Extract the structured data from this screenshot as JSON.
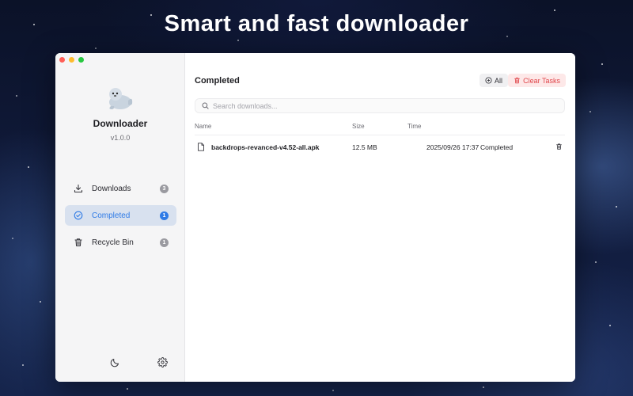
{
  "hero": {
    "title": "Smart and fast downloader"
  },
  "app": {
    "name": "Downloader",
    "version": "v1.0.0"
  },
  "sidebar": {
    "items": [
      {
        "label": "Downloads",
        "count": "3",
        "icon": "download-icon"
      },
      {
        "label": "Completed",
        "count": "1",
        "icon": "check-circle-icon",
        "active": true
      },
      {
        "label": "Recycle Bin",
        "count": "1",
        "icon": "trash-icon"
      }
    ],
    "footer": {
      "theme_icon": "moon-icon",
      "settings_icon": "gear-icon"
    }
  },
  "main": {
    "title": "Completed",
    "filter_button": "All",
    "clear_button": "Clear Tasks",
    "search": {
      "placeholder": "Search downloads...",
      "value": ""
    },
    "columns": {
      "name": "Name",
      "size": "Size",
      "time": "Time"
    },
    "rows": [
      {
        "name": "backdrops-revanced-v4.52-all.apk",
        "size": "12.5 MB",
        "time": "2025/09/26 17:37",
        "status": "Completed"
      }
    ]
  },
  "colors": {
    "accent": "#2f7be6",
    "danger": "#e0474c",
    "active_bg": "#d8e1ef"
  }
}
